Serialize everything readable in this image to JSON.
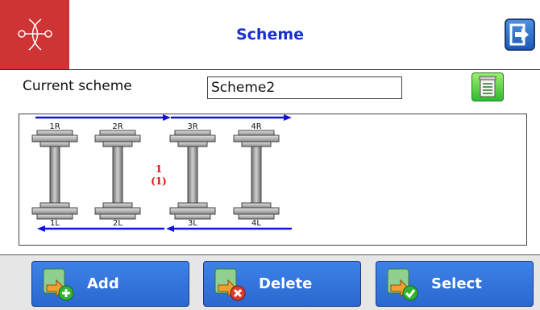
{
  "header": {
    "title": "Scheme",
    "logo_icon": "chassis-logo-icon",
    "exit_icon": "exit-icon",
    "brand_color": "#cf3434",
    "accent_color": "#1a2fd0"
  },
  "scheme": {
    "label": "Current scheme",
    "value": "Scheme2",
    "save_icon": "notepad-icon"
  },
  "wheelsets": {
    "top_labels": [
      "1R",
      "2R",
      "3R",
      "4R"
    ],
    "bottom_labels": [
      "1L",
      "2L",
      "3L",
      "4L"
    ],
    "bogie_number": "1",
    "bogie_count": "(1)"
  },
  "actions": {
    "add": "Add",
    "delete": "Delete",
    "select": "Select"
  }
}
